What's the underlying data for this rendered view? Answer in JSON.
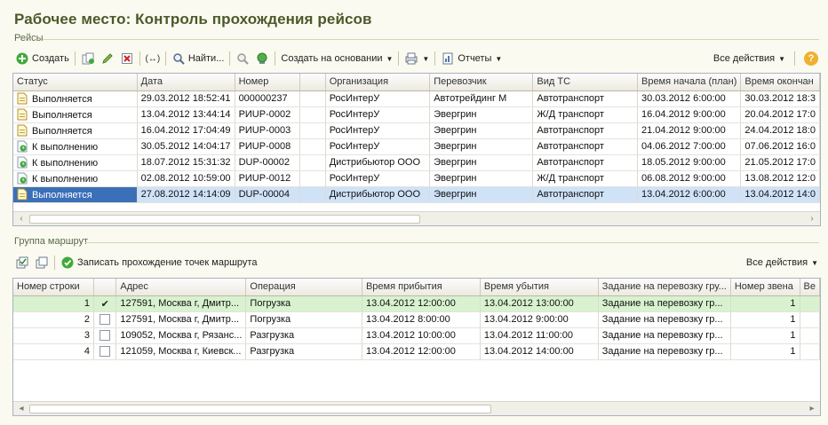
{
  "page": {
    "title": "Рабочее место: Контроль прохождения рейсов"
  },
  "trips_section": {
    "label": "Рейсы"
  },
  "toolbar": {
    "create": "Создать",
    "find": "Найти...",
    "create_based": "Создать на основании",
    "reports": "Отчеты",
    "all_actions": "Все действия",
    "help": "?"
  },
  "trips_table": {
    "columns": [
      "Статус",
      "Дата",
      "Номер",
      "Организация",
      "Перевозчик",
      "Вид ТС",
      "Время начала (план)",
      "Время окончан"
    ],
    "rows": [
      {
        "status": "Выполняется",
        "date": "29.03.2012 18:52:41",
        "number": "000000237",
        "org": "РосИнтерУ",
        "carrier": "Автотрейдинг М",
        "vehicle": "Автотранспорт",
        "start": "30.03.2012 6:00:00",
        "end": "30.03.2012 18:3"
      },
      {
        "status": "Выполняется",
        "date": "13.04.2012 13:44:14",
        "number": "РИUP-0002",
        "org": "РосИнтерУ",
        "carrier": "Эвергрин",
        "vehicle": "Ж/Д транспорт",
        "start": "16.04.2012 9:00:00",
        "end": "20.04.2012 17:0"
      },
      {
        "status": "Выполняется",
        "date": "16.04.2012 17:04:49",
        "number": "РИUP-0003",
        "org": "РосИнтерУ",
        "carrier": "Эвергрин",
        "vehicle": "Автотранспорт",
        "start": "21.04.2012 9:00:00",
        "end": "24.04.2012 18:0"
      },
      {
        "status": "К выполнению",
        "date": "30.05.2012 14:04:17",
        "number": "РИUP-0008",
        "org": "РосИнтерУ",
        "carrier": "Эвергрин",
        "vehicle": "Автотранспорт",
        "start": "04.06.2012 7:00:00",
        "end": "07.06.2012 16:0"
      },
      {
        "status": "К выполнению",
        "date": "18.07.2012 15:31:32",
        "number": "DUP-00002",
        "org": "Дистрибьютор ООО",
        "carrier": "Эвергрин",
        "vehicle": "Автотранспорт",
        "start": "18.05.2012 9:00:00",
        "end": "21.05.2012 17:0"
      },
      {
        "status": "К выполнению",
        "date": "02.08.2012 10:59:00",
        "number": "РИUP-0012",
        "org": "РосИнтерУ",
        "carrier": "Эвергрин",
        "vehicle": "Ж/Д транспорт",
        "start": "06.08.2012 9:00:00",
        "end": "13.08.2012 12:0"
      },
      {
        "status": "Выполняется",
        "date": "27.08.2012 14:14:09",
        "number": "DUP-00004",
        "org": "Дистрибьютор ООО",
        "carrier": "Эвергрин",
        "vehicle": "Автотранспорт",
        "start": "13.04.2012 6:00:00",
        "end": "13.04.2012 14:0"
      }
    ]
  },
  "route_section": {
    "label": "Группа маршрут"
  },
  "route_toolbar": {
    "record": "Записать прохождение точек маршрута",
    "all_actions": "Все действия"
  },
  "route_table": {
    "columns": [
      "Номер строки",
      "",
      "Адрес",
      "Операция",
      "Время прибытия",
      "Время убытия",
      "Задание на перевозку гру...",
      "Номер звена",
      "Ве"
    ],
    "rows": [
      {
        "n": "1",
        "checked": true,
        "address": "127591, Москва г, Дмитр...",
        "op": "Погрузка",
        "arrive": "13.04.2012 12:00:00",
        "depart": "13.04.2012 13:00:00",
        "task": "Задание на перевозку гр...",
        "link": "1"
      },
      {
        "n": "2",
        "checked": false,
        "address": "127591, Москва г, Дмитр...",
        "op": "Погрузка",
        "arrive": "13.04.2012 8:00:00",
        "depart": "13.04.2012 9:00:00",
        "task": "Задание на перевозку гр...",
        "link": "1"
      },
      {
        "n": "3",
        "checked": false,
        "address": "109052, Москва г, Рязанс...",
        "op": "Разгрузка",
        "arrive": "13.04.2012 10:00:00",
        "depart": "13.04.2012 11:00:00",
        "task": "Задание на перевозку гр...",
        "link": "1"
      },
      {
        "n": "4",
        "checked": false,
        "address": "121059, Москва г, Киевск...",
        "op": "Разгрузка",
        "arrive": "13.04.2012 12:00:00",
        "depart": "13.04.2012 14:00:00",
        "task": "Задание на перевозку гр...",
        "link": "1"
      }
    ]
  }
}
